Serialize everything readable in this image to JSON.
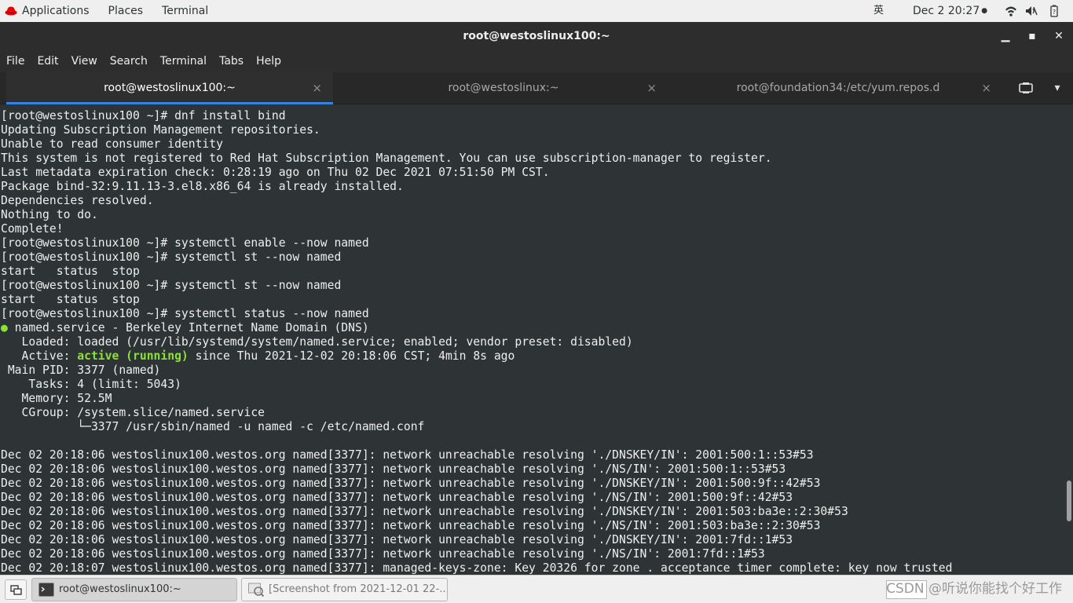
{
  "topbar": {
    "applications": "Applications",
    "places": "Places",
    "terminal": "Terminal",
    "input_method": "英",
    "clock": "Dec 2  20:27",
    "clock_dot": "●",
    "icons": [
      "wifi-icon",
      "volume-icon",
      "battery-icon"
    ]
  },
  "window": {
    "title": "root@westoslinux100:~",
    "minimize": "▁",
    "maximize": "▪",
    "close": "✕"
  },
  "menubar": [
    "File",
    "Edit",
    "View",
    "Search",
    "Terminal",
    "Tabs",
    "Help"
  ],
  "tabs": [
    {
      "label": "root@westoslinux100:~",
      "close": "×",
      "active": true
    },
    {
      "label": "root@westoslinux:~",
      "close": "×",
      "active": false
    },
    {
      "label": "root@foundation34:/etc/yum.repos.d",
      "close": "×",
      "active": false
    }
  ],
  "tab_buttons": {
    "new_tab_icon": "new-tab-icon",
    "menu": "▾"
  },
  "terminal": {
    "lines": [
      {
        "text": "[root@westoslinux100 ~]# dnf install bind"
      },
      {
        "text": "Updating Subscription Management repositories."
      },
      {
        "text": "Unable to read consumer identity"
      },
      {
        "text": "This system is not registered to Red Hat Subscription Management. You can use subscription-manager to register."
      },
      {
        "text": "Last metadata expiration check: 0:28:19 ago on Thu 02 Dec 2021 07:51:50 PM CST."
      },
      {
        "text": "Package bind-32:9.11.13-3.el8.x86_64 is already installed."
      },
      {
        "text": "Dependencies resolved."
      },
      {
        "text": "Nothing to do."
      },
      {
        "text": "Complete!"
      },
      {
        "text": "[root@westoslinux100 ~]# systemctl enable --now named"
      },
      {
        "text": "[root@westoslinux100 ~]# systemctl st --now named"
      },
      {
        "text": "start   status  stop"
      },
      {
        "text": "[root@westoslinux100 ~]# systemctl st --now named"
      },
      {
        "text": "start   status  stop"
      },
      {
        "text": "[root@westoslinux100 ~]# systemctl status --now named"
      },
      {
        "text": " named.service - Berkeley Internet Name Domain (DNS)",
        "prefix": "●"
      },
      {
        "text": "   Loaded: loaded (/usr/lib/systemd/system/named.service; enabled; vendor preset: disabled)"
      },
      {
        "text": " since Thu 2021-12-02 20:18:06 CST; 4min 8s ago",
        "prefix_plain": "   Active: ",
        "highlight": "active (running)"
      },
      {
        "text": " Main PID: 3377 (named)"
      },
      {
        "text": "    Tasks: 4 (limit: 5043)"
      },
      {
        "text": "   Memory: 52.5M"
      },
      {
        "text": "   CGroup: /system.slice/named.service"
      },
      {
        "text": "           └─3377 /usr/sbin/named -u named -c /etc/named.conf"
      },
      {
        "text": ""
      },
      {
        "text": "Dec 02 20:18:06 westoslinux100.westos.org named[3377]: network unreachable resolving './DNSKEY/IN': 2001:500:1::53#53"
      },
      {
        "text": "Dec 02 20:18:06 westoslinux100.westos.org named[3377]: network unreachable resolving './NS/IN': 2001:500:1::53#53"
      },
      {
        "text": "Dec 02 20:18:06 westoslinux100.westos.org named[3377]: network unreachable resolving './DNSKEY/IN': 2001:500:9f::42#53"
      },
      {
        "text": "Dec 02 20:18:06 westoslinux100.westos.org named[3377]: network unreachable resolving './NS/IN': 2001:500:9f::42#53"
      },
      {
        "text": "Dec 02 20:18:06 westoslinux100.westos.org named[3377]: network unreachable resolving './DNSKEY/IN': 2001:503:ba3e::2:30#53"
      },
      {
        "text": "Dec 02 20:18:06 westoslinux100.westos.org named[3377]: network unreachable resolving './NS/IN': 2001:503:ba3e::2:30#53"
      },
      {
        "text": "Dec 02 20:18:06 westoslinux100.westos.org named[3377]: network unreachable resolving './DNSKEY/IN': 2001:7fd::1#53"
      },
      {
        "text": "Dec 02 20:18:06 westoslinux100.westos.org named[3377]: network unreachable resolving './NS/IN': 2001:7fd::1#53"
      },
      {
        "text": "Dec 02 20:18:07 westoslinux100.westos.org named[3377]: managed-keys-zone: Key 20326 for zone . acceptance timer complete: key now trusted"
      }
    ],
    "colors": {
      "background": "#2e3436",
      "foreground": "#eeeeec",
      "green": "#8ae234"
    }
  },
  "taskbar": {
    "items": [
      {
        "label": "root@westoslinux100:~",
        "active": true
      },
      {
        "label": "[Screenshot from 2021-12-01 22-...",
        "active": false
      }
    ],
    "watermark": "CSDN @听说你能找个好工作"
  }
}
